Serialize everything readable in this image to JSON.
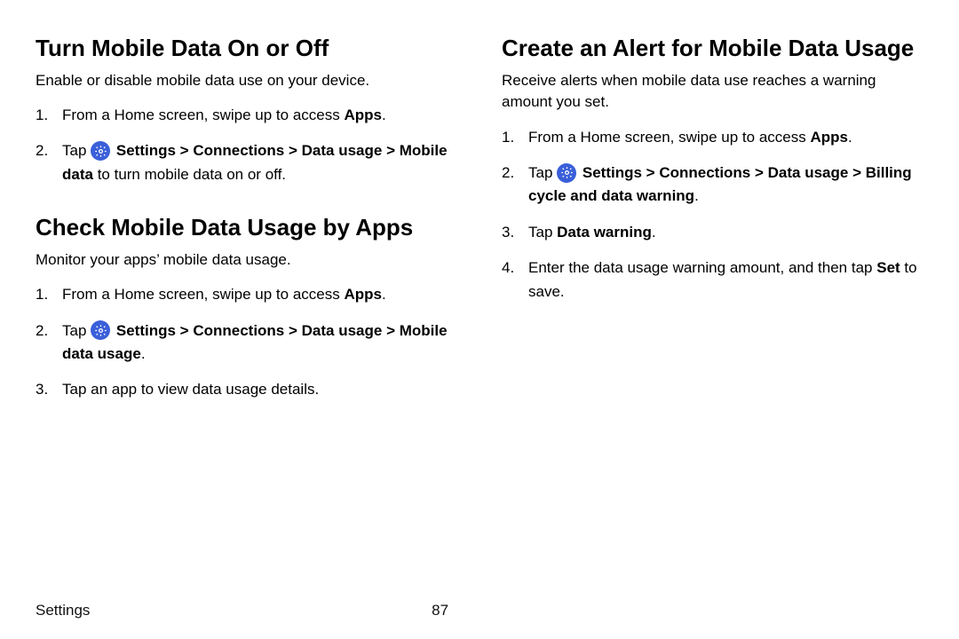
{
  "left": {
    "section1": {
      "title": "Turn Mobile Data On or Off",
      "desc": "Enable or disable mobile data use on your device.",
      "steps": {
        "s1_pre": "From a Home screen, swipe up to access ",
        "s1_b1": "Apps",
        "s1_post": ".",
        "s2_pre": "Tap ",
        "s2_b1": "Settings",
        "s2_chev1": " > ",
        "s2_b2": "Connections",
        "s2_chev2": " > ",
        "s2_b3": "Data usage",
        "s2_chev3": " > ",
        "s2_b4": "Mobile data",
        "s2_post": " to turn mobile data on or off."
      }
    },
    "section2": {
      "title": "Check Mobile Data Usage by Apps",
      "desc": "Monitor your apps’ mobile data usage.",
      "steps": {
        "s1_pre": "From a Home screen, swipe up to access ",
        "s1_b1": "Apps",
        "s1_post": ".",
        "s2_pre": "Tap ",
        "s2_b1": "Settings",
        "s2_chev1": " > ",
        "s2_b2": "Connections",
        "s2_chev2": " > ",
        "s2_b3": "Data usage",
        "s2_chev3": " > ",
        "s2_b4": "Mobile data usage",
        "s2_post": ".",
        "s3": "Tap an app to view data usage details."
      }
    }
  },
  "right": {
    "section1": {
      "title": "Create an Alert for Mobile Data Usage",
      "desc": "Receive alerts when mobile data use reaches a warning amount you set.",
      "steps": {
        "s1_pre": "From a Home screen, swipe up to access ",
        "s1_b1": "Apps",
        "s1_post": ".",
        "s2_pre": "Tap ",
        "s2_b1": "Settings",
        "s2_chev1": " > ",
        "s2_b2": "Connections",
        "s2_chev2": " > ",
        "s2_b3": "Data usage",
        "s2_chev3": " > ",
        "s2_b4": "Billing cycle and data warning",
        "s2_post": ".",
        "s3_pre": "Tap ",
        "s3_b1": "Data warning",
        "s3_post": ".",
        "s4_pre": "Enter the data usage warning amount, and then tap ",
        "s4_b1": "Set",
        "s4_post": " to save."
      }
    }
  },
  "footer": {
    "label": "Settings",
    "page": "87"
  }
}
